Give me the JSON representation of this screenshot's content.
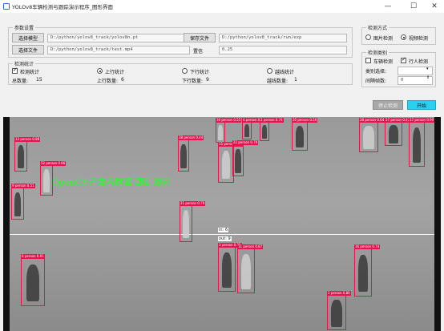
{
  "window": {
    "title": "YOLOv8车辆检测与跟踪演示程序_图形界面",
    "minimize": "—",
    "maximize": "☐",
    "close": "✕"
  },
  "config_group": {
    "title": "参数设置",
    "model_button": "选择模型",
    "model_path": "D:/python/yolov8_track/yolov8n.pt",
    "save_button": "保存文件",
    "save_path": "D:/python/yolov8_track/run/exp",
    "source_button": "选择文件",
    "source_path": "D:/python/yolov8_track/test.mp4",
    "conf_label": "置信",
    "conf_value": "0.25"
  },
  "display_group": {
    "title": "检测方式",
    "option_image": "图片检测",
    "option_video": "视频检测"
  },
  "target_group": {
    "title": "检测类别",
    "car_label": "车辆检测",
    "person_label": "行人检测",
    "class_label": "类别选择:",
    "class_value": "",
    "frame_label": "间隔帧数:",
    "frame_value": "0"
  },
  "stats_group": {
    "title": "检测统计",
    "check_total": "检测统计",
    "check_up": "上行统计",
    "check_down": "下行统计",
    "check_cross": "越线统计",
    "total_label": "总数量:",
    "total_value": "15",
    "up_label": "上行数量:",
    "up_value": "6",
    "down_label": "下行数量:",
    "down_value": "9",
    "cross_label": "越线数量:",
    "cross_value": "1"
  },
  "actions": {
    "stop_button": "停止检测",
    "start_button": "开始"
  },
  "video": {
    "watermark": "OpenCV开发者联盟-跟踪演示",
    "counter_in": "in: 6",
    "counter_out": "out: 9",
    "detections": [
      {
        "label": "13 person 0.88"
      },
      {
        "label": "52 person 0.66"
      },
      {
        "label": "9 person 0.51"
      },
      {
        "label": "38 person 0.44"
      },
      {
        "label": "10 person 0.55"
      },
      {
        "label": "4 person 0.92"
      },
      {
        "label": "2 person 0.74"
      },
      {
        "label": "15 person 0.83"
      },
      {
        "label": "22 person 0.79"
      },
      {
        "label": "35 person 0.56"
      },
      {
        "label": "28 person 0.64"
      },
      {
        "label": "57 person 0.42"
      },
      {
        "label": "17 person 0.90"
      },
      {
        "label": "21 person 0.79"
      },
      {
        "label": "6 person 0.91"
      },
      {
        "label": "3 person 0.85"
      },
      {
        "label": "11 person 0.87"
      },
      {
        "label": "16 person 0.74"
      },
      {
        "label": "1 person 0.80"
      }
    ]
  },
  "colors": {
    "box": "#e8124f",
    "watermark": "#27ff27",
    "start_button": "#2ad0f0"
  }
}
